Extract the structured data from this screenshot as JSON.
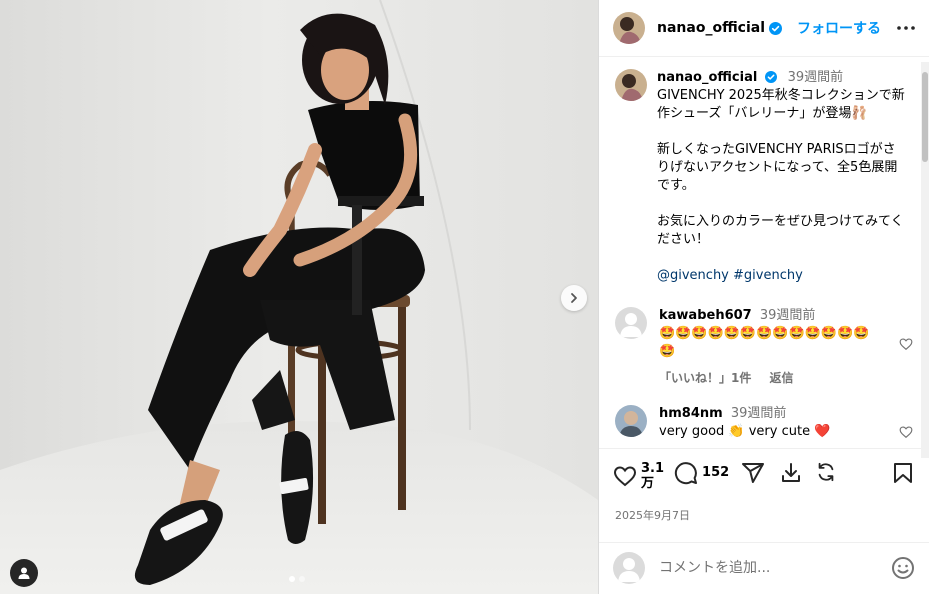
{
  "colors": {
    "accent": "#0095f6",
    "hashtag": "#00376b",
    "muted": "#737373",
    "like_red": "#ed4956"
  },
  "header": {
    "username": "nanao_official",
    "follow_label": "フォローする"
  },
  "caption": {
    "username": "nanao_official",
    "time": "39週間前",
    "paragraphs": [
      "GIVENCHY 2025年秋冬コレクションで新作シューズ「バレリーナ」が登場🩰",
      "新しくなったGIVENCHY PARISロゴがさりげないアクセントになって、全5色展開です。",
      "お気に入りのカラーをぜひ見つけてみてください！"
    ],
    "hashtags": [
      "@givenchy",
      "#givenchy"
    ]
  },
  "comments": [
    {
      "username": "kawabeh607",
      "time": "39週間前",
      "text": "🤩🤩🤩🤩🤩🤩🤩🤩🤩🤩🤩🤩🤩🤩",
      "likes_label": "「いいね！」1件",
      "reply_label": "返信"
    },
    {
      "username": "hm84nm",
      "time": "39週間前",
      "text": "very good 👏 very cute ❤️"
    }
  ],
  "actions": {
    "likes_count": "3.1\n万",
    "comments_count": "152"
  },
  "post_date": "2025年9月7日",
  "add_comment": {
    "placeholder": "コメントを追加..."
  },
  "carousel": {
    "total": 2,
    "current": 1
  },
  "icons": [
    "next-chevron-icon",
    "user-tag-icon",
    "verified-badge-icon",
    "more-icon",
    "heart-icon",
    "comment-icon",
    "share-icon",
    "save-icon",
    "repost-icon",
    "bookmark-icon",
    "emoji-icon"
  ]
}
